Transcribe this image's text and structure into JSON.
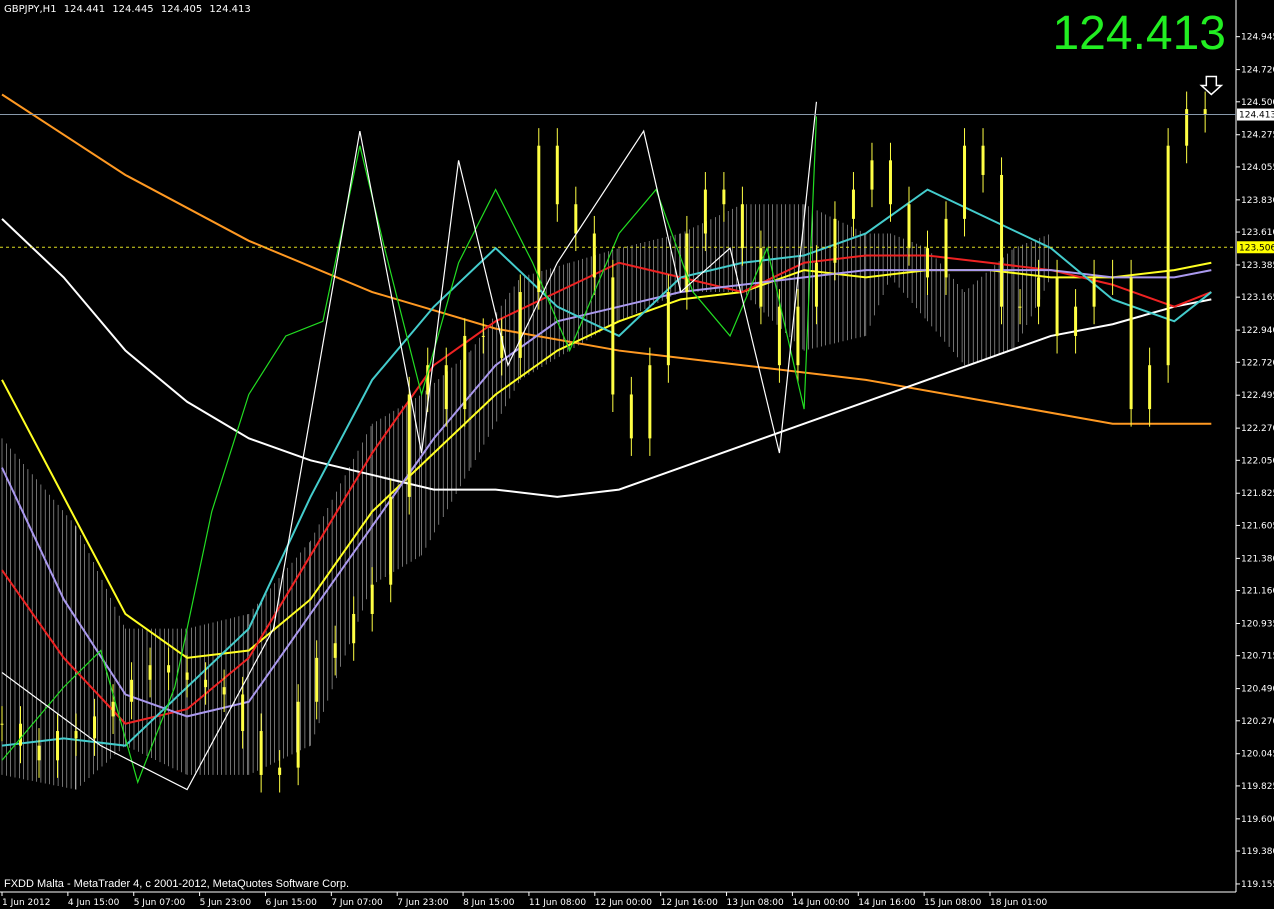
{
  "header": {
    "symbol": "GBPJPY,H1",
    "ohlc": [
      "124.441",
      "124.445",
      "124.405",
      "124.413"
    ]
  },
  "big_price": "124.413",
  "footer": "FXDD Malta - MetaTrader 4, c 2001-2012, MetaQuotes Software Corp.",
  "colors": {
    "background": "#000000",
    "candles": "#ffff44",
    "zigzag_green": "#22dd22",
    "zigzag_white": "#ffffff",
    "ma_orange": "#ff9922",
    "ma_white": "#ffffff",
    "ma_yellow": "#ffff22",
    "ma_red": "#ee2222",
    "ma_purple": "#aa99ee",
    "ma_cyan": "#44cccc",
    "cloud": "#bbbbbb",
    "price_line": "#8899aa",
    "big_price": "#22ee22"
  },
  "chart_data": {
    "type": "line",
    "title": "GBPJPY,H1",
    "price_axis_ticks": [
      "124.945",
      "124.720",
      "124.500",
      "124.275",
      "124.055",
      "123.830",
      "123.610",
      "123.385",
      "123.165",
      "122.940",
      "122.720",
      "122.495",
      "122.270",
      "122.050",
      "121.825",
      "121.605",
      "121.380",
      "121.160",
      "120.935",
      "120.715",
      "120.490",
      "120.270",
      "120.045",
      "119.825",
      "119.600",
      "119.380",
      "119.155"
    ],
    "time_axis_ticks": [
      "1 Jun 2012",
      "4 Jun 15:00",
      "5 Jun 07:00",
      "5 Jun 23:00",
      "6 Jun 15:00",
      "7 Jun 07:00",
      "7 Jun 23:00",
      "8 Jun 15:00",
      "11 Jun 08:00",
      "12 Jun 00:00",
      "12 Jun 16:00",
      "13 Jun 08:00",
      "14 Jun 00:00",
      "14 Jun 16:00",
      "15 Jun 08:00",
      "18 Jun 01:00"
    ],
    "current_price": 124.413,
    "current_price_label": "124.413",
    "marked_level": 123.506,
    "marked_level_label": "123.506",
    "ylim": [
      119.1,
      125.1
    ],
    "grid": false,
    "series": [
      {
        "key": "close",
        "type": "candles",
        "values": [
          120.25,
          120.1,
          120.0,
          120.2,
          120.15,
          120.3,
          120.4,
          120.55,
          120.65,
          120.6,
          120.55,
          120.5,
          120.45,
          120.2,
          119.9,
          119.95,
          120.4,
          120.7,
          120.8,
          121.0,
          121.2,
          121.8,
          122.5,
          122.7,
          122.4,
          122.9,
          122.9,
          122.75,
          123.2,
          124.2,
          123.8,
          123.6,
          123.3,
          122.5,
          122.2,
          122.7,
          123.2,
          123.6,
          123.9,
          123.8,
          123.5,
          123.1,
          122.7,
          123.1,
          123.4,
          123.7,
          123.9,
          124.1,
          123.8,
          123.5,
          123.3,
          123.7,
          124.2,
          124.0,
          123.1,
          123.1,
          123.3,
          122.9,
          123.1,
          123.3,
          123.3,
          122.4,
          122.7,
          124.2,
          124.45,
          124.41
        ],
        "idx": [
          0,
          1,
          2,
          3,
          4,
          5,
          6,
          7,
          8,
          9,
          10,
          11,
          12,
          13,
          14,
          15,
          16,
          17,
          18,
          19,
          20,
          21,
          22,
          23,
          24,
          25,
          26,
          27,
          28,
          29,
          30,
          31,
          32,
          33,
          34,
          35,
          36,
          37,
          38,
          39,
          40,
          41,
          42,
          43,
          44,
          45,
          46,
          47,
          48,
          49,
          50,
          51,
          52,
          53,
          54,
          55,
          56,
          57,
          58,
          59,
          60,
          61,
          62,
          63,
          64,
          65
        ]
      },
      {
        "key": "ma_orange",
        "x": [
          0,
          10,
          20,
          30,
          40,
          50,
          60,
          70,
          80,
          90,
          98
        ],
        "y": [
          124.55,
          124.0,
          123.55,
          123.2,
          122.95,
          122.8,
          122.7,
          122.6,
          122.45,
          122.3,
          122.3
        ]
      },
      {
        "key": "ma_white",
        "x": [
          0,
          5,
          10,
          15,
          20,
          25,
          30,
          35,
          40,
          45,
          50,
          55,
          60,
          65,
          70,
          75,
          80,
          85,
          90,
          95,
          98
        ],
        "y": [
          123.7,
          123.3,
          122.8,
          122.45,
          122.2,
          122.05,
          121.95,
          121.85,
          121.85,
          121.8,
          121.85,
          122.0,
          122.15,
          122.3,
          122.45,
          122.6,
          122.75,
          122.9,
          122.98,
          123.1,
          123.15
        ]
      },
      {
        "key": "ma_yellow",
        "x": [
          0,
          5,
          10,
          15,
          20,
          25,
          30,
          35,
          40,
          45,
          50,
          55,
          60,
          65,
          70,
          75,
          80,
          85,
          90,
          95,
          98
        ],
        "y": [
          122.6,
          121.8,
          121.0,
          120.7,
          120.75,
          121.1,
          121.7,
          122.1,
          122.5,
          122.8,
          123.0,
          123.15,
          123.2,
          123.35,
          123.3,
          123.35,
          123.35,
          123.3,
          123.3,
          123.35,
          123.4
        ]
      },
      {
        "key": "ma_red",
        "x": [
          0,
          5,
          10,
          15,
          20,
          25,
          30,
          35,
          40,
          45,
          50,
          55,
          60,
          65,
          70,
          75,
          80,
          85,
          90,
          95,
          98
        ],
        "y": [
          121.3,
          120.7,
          120.25,
          120.35,
          120.7,
          121.4,
          122.1,
          122.7,
          123.0,
          123.2,
          123.4,
          123.3,
          123.2,
          123.4,
          123.45,
          123.45,
          123.4,
          123.35,
          123.25,
          123.1,
          123.2
        ]
      },
      {
        "key": "ma_purple",
        "x": [
          0,
          5,
          10,
          15,
          20,
          25,
          30,
          35,
          40,
          45,
          50,
          55,
          60,
          65,
          70,
          75,
          80,
          85,
          90,
          95,
          98
        ],
        "y": [
          122.0,
          121.1,
          120.45,
          120.3,
          120.4,
          121.0,
          121.6,
          122.2,
          122.7,
          123.0,
          123.1,
          123.2,
          123.25,
          123.3,
          123.35,
          123.35,
          123.35,
          123.35,
          123.3,
          123.3,
          123.35
        ]
      },
      {
        "key": "ma_cyan",
        "x": [
          0,
          5,
          10,
          15,
          20,
          25,
          30,
          35,
          40,
          45,
          50,
          55,
          60,
          65,
          70,
          75,
          80,
          85,
          90,
          95,
          98
        ],
        "y": [
          120.1,
          120.15,
          120.1,
          120.5,
          120.9,
          121.8,
          122.6,
          123.1,
          123.5,
          123.1,
          122.9,
          123.3,
          123.4,
          123.45,
          123.6,
          123.9,
          123.7,
          123.5,
          123.15,
          123.0,
          123.2
        ]
      },
      {
        "key": "zigzag_green",
        "x": [
          0,
          5,
          8,
          11,
          14,
          17,
          20,
          23,
          26,
          29,
          31,
          34,
          37,
          40,
          43,
          46,
          50,
          53,
          56,
          59,
          62,
          65,
          66
        ],
        "y": [
          120.0,
          120.5,
          120.75,
          119.85,
          120.5,
          121.7,
          122.5,
          122.9,
          123.0,
          124.2,
          123.5,
          122.5,
          123.4,
          123.9,
          123.4,
          122.8,
          123.6,
          123.9,
          123.2,
          122.9,
          123.5,
          122.4,
          124.4
        ]
      },
      {
        "key": "zigzag_white",
        "x": [
          0,
          8,
          15,
          22,
          29,
          34,
          37,
          41,
          45,
          52,
          55,
          59,
          63,
          66
        ],
        "y": [
          120.6,
          120.1,
          119.8,
          120.9,
          124.3,
          122.1,
          124.1,
          122.7,
          123.4,
          124.3,
          123.2,
          123.5,
          122.1,
          124.5
        ]
      }
    ]
  }
}
